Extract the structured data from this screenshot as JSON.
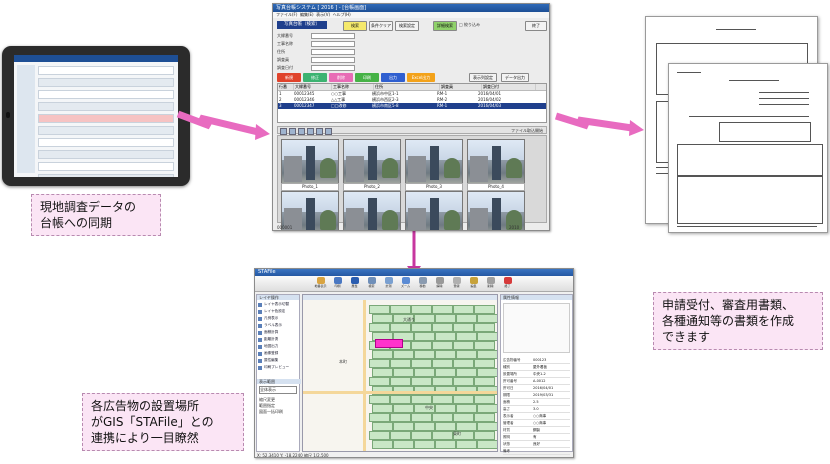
{
  "callouts": {
    "sync": [
      "現地調査データの",
      "台帳への同期"
    ],
    "documents": [
      "申請受付、審査用書類、",
      "各種通知等の書類を作成",
      "できます"
    ],
    "gis": [
      "各広告物の設置場所",
      "がGIS「STAFile」との",
      "連携により一目瞭然"
    ]
  },
  "ledger_window": {
    "title": "写真台帳システム [ 2016 ] - [台帳画面]",
    "menu": [
      "ファイル(F)",
      "編集(E)",
      "表示(V)",
      "ヘルプ(H)"
    ],
    "header_label": "写真台帳（検索）",
    "top_buttons": [
      "検索",
      "条件クリア",
      "検索設定",
      "詳細検索"
    ],
    "checkbox_label": "□ 絞り込み",
    "close_button": "終了",
    "fields": [
      "大縁番号",
      "工事名称",
      "住所",
      "調査員",
      "調査日付"
    ],
    "color_buttons": [
      {
        "label": "新規",
        "color": "#e0432b"
      },
      {
        "label": "修正",
        "color": "#3cb371"
      },
      {
        "label": "削除",
        "color": "#e86bb5"
      },
      {
        "label": "印刷",
        "color": "#46b246"
      },
      {
        "label": "出力",
        "color": "#2f5fd0"
      },
      {
        "label": "Excel出力",
        "color": "#f3a21a"
      }
    ],
    "right_buttons": [
      "表示列設定",
      "データ出力"
    ],
    "table": {
      "columns": [
        "行番",
        "大縁番号",
        "工事名称",
        "住所",
        "調査員",
        "調査日付"
      ],
      "rows": [
        [
          "1",
          "00012345",
          "○○工事",
          "横浜市中区1-1",
          "RM-1",
          "2016/04/01"
        ],
        [
          "2",
          "00012346",
          "△△工事",
          "横浜市西区2-3",
          "RM-2",
          "2016/04/02"
        ],
        [
          "3",
          "00012347",
          "□□改修",
          "横浜市南区5-8",
          "RM-1",
          "2016/04/03"
        ]
      ],
      "selected_row": 2
    },
    "photo_toolbar_label": "ファイル取込開始",
    "photos": [
      "Photo_1",
      "Photo_2",
      "Photo_3",
      "Photo_4",
      "Photo_5",
      "Photo_6",
      "Photo_7",
      "Photo_8"
    ],
    "status_left": "000001",
    "status_right": "2010"
  },
  "gis_window": {
    "title": "STAFile",
    "toolbar": [
      "地番表示",
      "印刷",
      "属性",
      "検索",
      "計測",
      "ズーム",
      "移動",
      "解除",
      "登録",
      "編集",
      "削除",
      "終了"
    ],
    "left_panel_title": "レイヤ操作",
    "left_items": [
      "レイヤ表示切替",
      "レイヤ色設定",
      "凡例表示",
      "ラベル表示",
      "面積計算",
      "距離計測",
      "地図出力",
      "画像登録",
      "属性編集",
      "印刷プレビュー"
    ],
    "left_subtitle": "表示範囲",
    "left_select": "全体表示",
    "left_footer": [
      "縮尺変更",
      "範囲指定",
      "図面一括印刷"
    ],
    "map_labels": [
      "大通り",
      "本町",
      "中央",
      "東町"
    ],
    "attr_panel_title": "属性情報",
    "attr_rows": [
      [
        "広告物番号",
        "000123"
      ],
      [
        "種別",
        "屋外看板"
      ],
      [
        "設置場所",
        "中央1-2"
      ],
      [
        "許可番号",
        "A-0012"
      ],
      [
        "許可日",
        "2016/04/01"
      ],
      [
        "期限",
        "2019/03/31"
      ],
      [
        "面積",
        "2.5"
      ],
      [
        "高さ",
        "3.0"
      ],
      [
        "表示者",
        "○○商事"
      ],
      [
        "管理者",
        "○○商事"
      ],
      [
        "材質",
        "鋼製"
      ],
      [
        "照明",
        "有"
      ],
      [
        "状態",
        "良好"
      ],
      [
        "備考",
        ""
      ]
    ],
    "status": "X: 52,3410  Y: -18,2240  縮尺 1/2,500"
  }
}
